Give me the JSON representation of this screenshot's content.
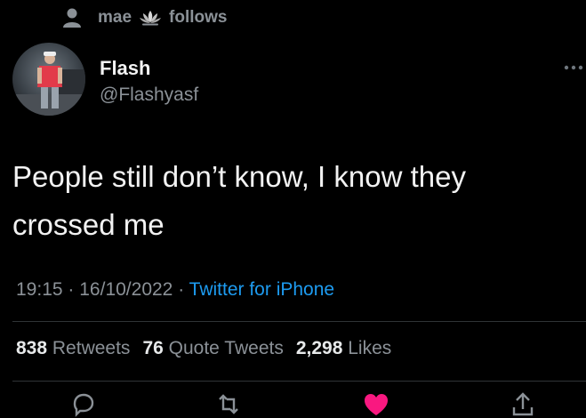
{
  "social_context": {
    "name": "mae",
    "suffix": "follows",
    "emoji_icon": "lotus-emoji-icon"
  },
  "author": {
    "display_name": "Flash",
    "handle": "@Flashyasf"
  },
  "tweet": {
    "text_line_1": "People still don’t know, I know they",
    "text_line_2": "crossed me"
  },
  "meta": {
    "time": "19:15",
    "separator": "·",
    "date": "16/10/2022",
    "source": "Twitter for iPhone"
  },
  "stats": {
    "retweets_count": "838",
    "retweets_label": "Retweets",
    "quotes_count": "76",
    "quotes_label": "Quote Tweets",
    "likes_count": "2,298",
    "likes_label": "Likes"
  },
  "actions": {
    "icons": [
      "reply-icon",
      "retweet-icon",
      "like-icon",
      "share-icon"
    ]
  },
  "colors": {
    "background": "#000000",
    "primary_text": "#e7e9ea",
    "secondary_text": "#8b9197",
    "link": "#1d9bf0",
    "like": "#f91880"
  }
}
